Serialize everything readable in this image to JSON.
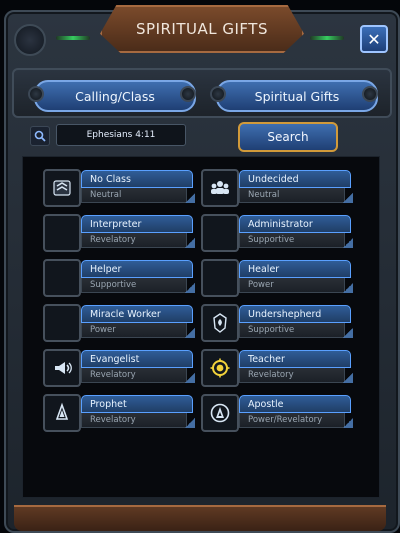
{
  "title": "SPIRITUAL GIFTS",
  "close_label": "✕",
  "tabs": [
    {
      "label": "Calling/Class"
    },
    {
      "label": "Spiritual Gifts"
    }
  ],
  "search": {
    "value": "Ephesians 4:11",
    "button_label": "Search"
  },
  "gifts": [
    {
      "name": "No Class",
      "type": "Neutral",
      "icon": "stacked-chevrons-icon"
    },
    {
      "name": "Undecided",
      "type": "Neutral",
      "icon": "group-icon"
    },
    {
      "name": "Interpreter",
      "type": "Revelatory",
      "icon": "empty-slot-icon"
    },
    {
      "name": "Administrator",
      "type": "Supportive",
      "icon": "empty-slot-icon"
    },
    {
      "name": "Helper",
      "type": "Supportive",
      "icon": "empty-slot-icon"
    },
    {
      "name": "Healer",
      "type": "Power",
      "icon": "empty-slot-icon"
    },
    {
      "name": "Miracle Worker",
      "type": "Power",
      "icon": "empty-slot-icon"
    },
    {
      "name": "Undershepherd",
      "type": "Supportive",
      "icon": "shield-drop-icon"
    },
    {
      "name": "Evangelist",
      "type": "Revelatory",
      "icon": "megaphone-icon"
    },
    {
      "name": "Teacher",
      "type": "Revelatory",
      "icon": "radiant-gear-icon"
    },
    {
      "name": "Prophet",
      "type": "Revelatory",
      "icon": "spire-icon"
    },
    {
      "name": "Apostle",
      "type": "Power/Revelatory",
      "icon": "spire-circle-icon"
    }
  ],
  "colors": {
    "panel": "#1d242c",
    "accent_blue": "#3f6fb0",
    "title_bronze": "#7a4a2b",
    "teacher_yellow": "#f2d23a"
  }
}
